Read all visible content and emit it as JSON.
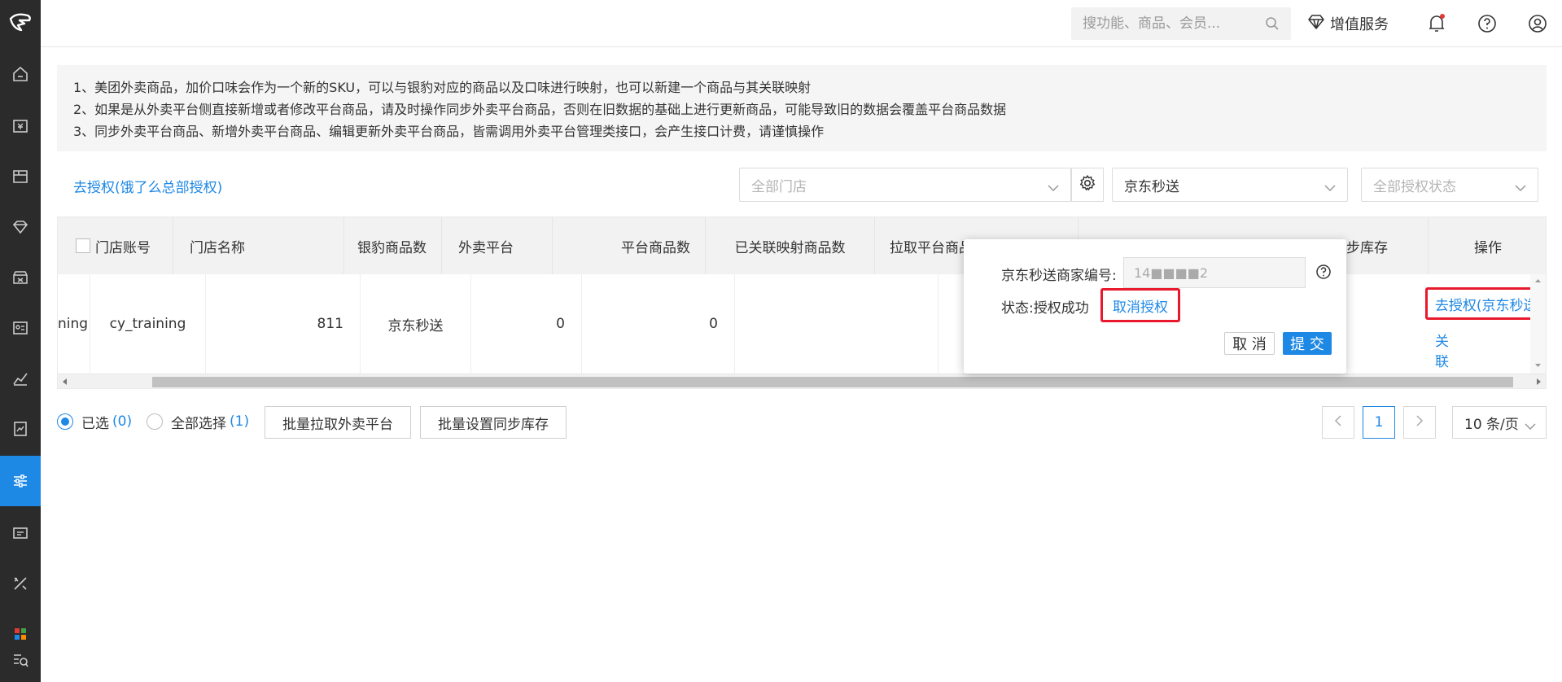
{
  "topbar": {
    "search_placeholder": "搜功能、商品、会员...",
    "value_added_service": "增值服务"
  },
  "notice": {
    "lines": [
      "1、美团外卖商品，加价口味会作为一个新的SKU，可以与银豹对应的商品以及口味进行映射，也可以新建一个商品与其关联映射",
      "2、如果是从外卖平台侧直接新增或者修改平台商品，请及时操作同步外卖平台商品，否则在旧数据的基础上进行更新商品，可能导致旧的数据会覆盖平台商品数据",
      "3、同步外卖平台商品、新增外卖平台商品、编辑更新外卖平台商品，皆需调用外卖平台管理类接口，会产生接口计费，请谨慎操作"
    ]
  },
  "filters": {
    "auth_link": "去授权(饿了么总部授权)",
    "store_placeholder": "全部门店",
    "platform_value": "京东秒送",
    "status_placeholder": "全部授权状态"
  },
  "table": {
    "headers": {
      "account": "门店账号",
      "name": "门店名称",
      "yinbao_count": "银豹商品数",
      "platform": "外卖平台",
      "platform_count": "平台商品数",
      "mapped_count": "已关联映射商品数",
      "pull_time": "拉取平台商品时间",
      "sync_stock": "同步库存",
      "action": "操作"
    },
    "rows": [
      {
        "account": "ning",
        "name": "cy_training",
        "yinbao_count": "811",
        "platform": "京东秒送",
        "platform_count": "0",
        "mapped_count": "0",
        "action_auth": "去授权(京东秒送授权)",
        "action_link_store": "关联门店"
      }
    ]
  },
  "popover": {
    "merchant_label": "京东秒送商家编号:",
    "merchant_value": "14■■■■2",
    "status_label": "状态:授权成功",
    "revoke_link": "取消授权",
    "cancel_btn": "取 消",
    "submit_btn": "提 交"
  },
  "footer": {
    "selected_label": "已选",
    "selected_count": "(0)",
    "select_all_label": "全部选择",
    "select_all_count": "(1)",
    "batch_pull": "批量拉取外卖平台",
    "batch_stock": "批量设置同步库存",
    "page_current": "1",
    "page_size": "10 条/页"
  },
  "colors": {
    "accent": "#1e88e5",
    "highlight_box": "#e8192c",
    "sidebar": "#2b2b2b"
  }
}
